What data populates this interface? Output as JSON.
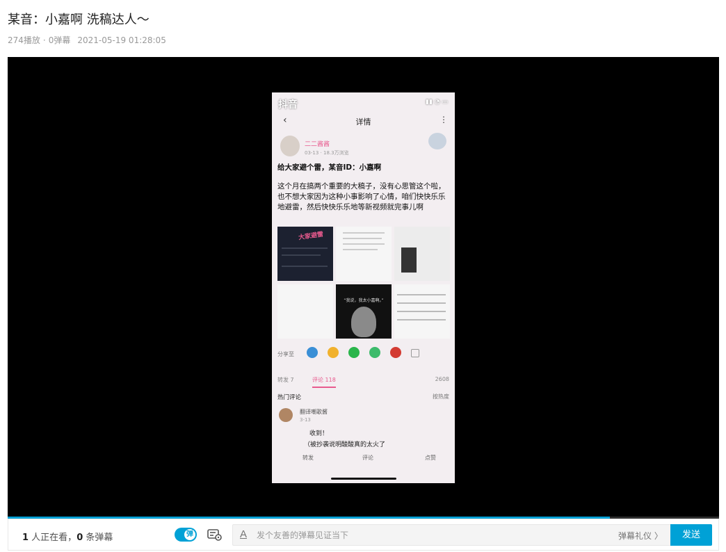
{
  "header": {
    "title": "某音：小嘉啊 洗稿达人～",
    "plays": "274播放",
    "separator": "·",
    "danmaku_count": "0弹幕",
    "datetime": "2021-05-19 01:28:05"
  },
  "video_frame": {
    "app_logo": "抖音",
    "nav_title": "详情",
    "username": "二二酱酱",
    "post_date": "03-13 · 18.3万浏览",
    "line1": "给大家避个雷，某音ID：小嘉啊",
    "body": "这个月在搞两个重要的大稿子，没有心思管这个啦，也不想大家因为这种小事影响了心情，咱们快快乐乐地避雷，然后快快乐乐地等新视频就完事儿啊",
    "image_caption": "大家避雷",
    "quote_caption": "“我说，我太小嘉啊。”",
    "share_label": "分享至",
    "tab_forward": "转发 7",
    "tab_comment": "评论 118",
    "tab_like": "2608",
    "hot_comments": "热门评论",
    "sort": "按热度",
    "commenter": "翻译嘲歌酱",
    "comment_time": "3-13",
    "comment_line1": "收到！",
    "comment_line2": "（被抄袭说明酸酸真的太火了",
    "action_forward": "转发",
    "action_comment": "评论",
    "action_like": "点赞"
  },
  "progress": {
    "buffered_fraction": 0.847
  },
  "bottom_bar": {
    "viewers_num": "1",
    "viewers_text": " 人正在看，",
    "danmaku_num": "0",
    "danmaku_text": " 条弹幕",
    "toggle_glyph": "弹",
    "font_icon": "A",
    "input_placeholder": "发个友善的弹幕见证当下",
    "etiquette": "弹幕礼仪 〉",
    "send": "发送"
  },
  "colors": {
    "accent": "#00a1d6",
    "player_bg": "#000000"
  },
  "icons": [
    "danmaku-toggle-icon",
    "danmaku-settings-icon",
    "font-style-icon"
  ]
}
